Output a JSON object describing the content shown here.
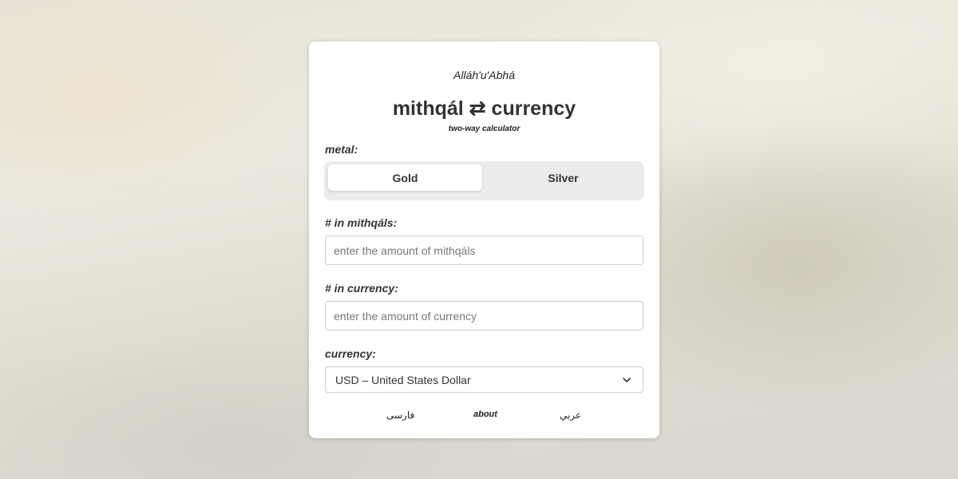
{
  "header": {
    "greeting": "Alláh'u'Abhá",
    "title": "mithqál ⇄ currency",
    "subtitle": "two-way calculator"
  },
  "metal": {
    "label": "metal:",
    "options": [
      {
        "label": "Gold",
        "selected": true
      },
      {
        "label": "Silver",
        "selected": false
      }
    ]
  },
  "mithqals": {
    "label": "# in mithqáls:",
    "value": "",
    "placeholder": "enter the amount of mithqáls"
  },
  "currency_amount": {
    "label": "# in currency:",
    "value": "",
    "placeholder": "enter the amount of currency"
  },
  "currency_select": {
    "label": "currency:",
    "selected": "USD – United States Dollar",
    "icon": "chevron-down-icon"
  },
  "footer": {
    "links": [
      {
        "label": "فارسی"
      },
      {
        "label": "about"
      },
      {
        "label": "عربي"
      }
    ]
  }
}
